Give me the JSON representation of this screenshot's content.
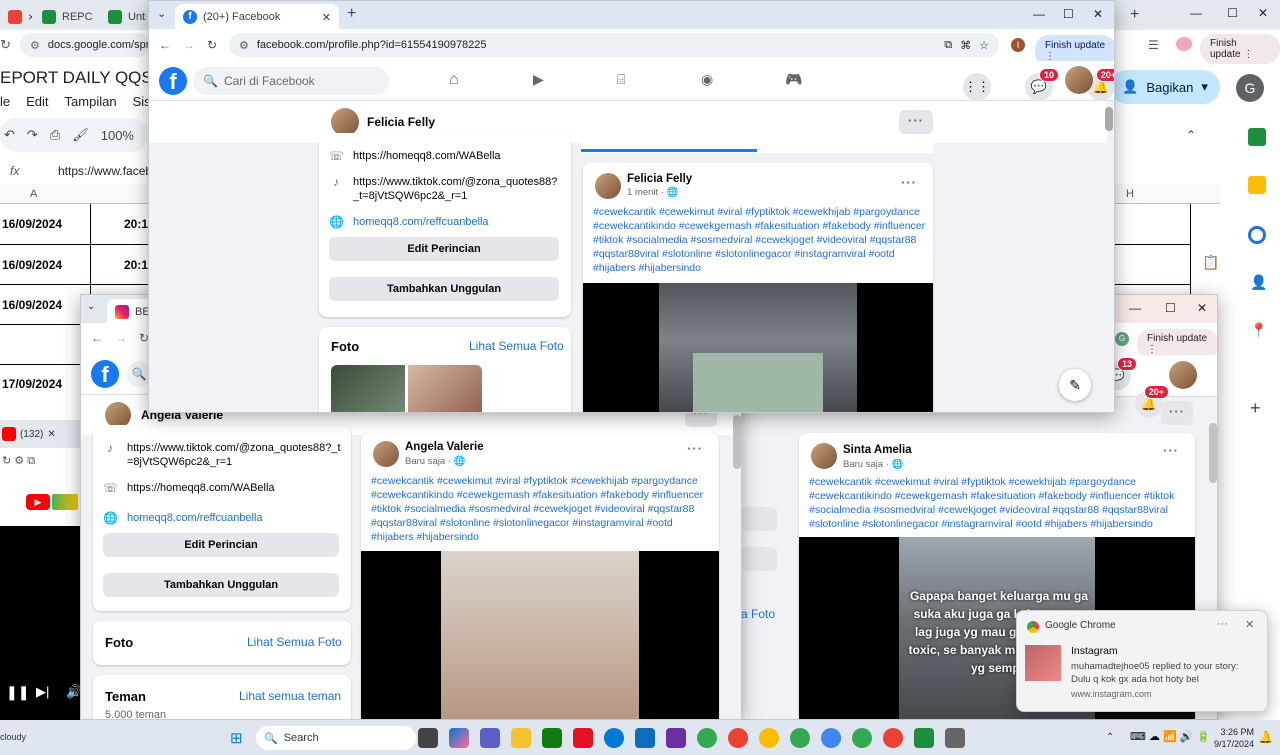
{
  "bg_sheet": {
    "tabs": [
      "REPC",
      "Untit"
    ],
    "url": "docs.google.com/spread",
    "doc_title": "EPORT DAILY QQSTA",
    "menu": [
      "le",
      "Edit",
      "Tampilan",
      "Sisip"
    ],
    "zoom": "100%",
    "cell_ref": "A",
    "formula": "https://www.faceb",
    "col_a": "A",
    "col_h": "H",
    "dates": [
      "16/09/2024",
      "16/09/2024",
      "16/09/2024",
      "17/09/2024"
    ],
    "times": [
      "20:1",
      "20:1"
    ],
    "share_label": "Bagikan",
    "avatar_letter": "G",
    "finish_update": "Finish update"
  },
  "yt_window": {
    "tab_label": "(132)"
  },
  "main_window": {
    "tab_title": "(20+) Facebook",
    "url": "facebook.com/profile.php?id=61554190978225",
    "finish_update": "Finish update",
    "profile_initial": "I",
    "search_placeholder": "Cari di Facebook",
    "messenger_badge": "10",
    "notif_badge": "20+",
    "profile_name": "Felicia Felly",
    "intro": {
      "whatsapp": "https://homeqq8.com/WABella",
      "tiktok": "https://www.tiktok.com/@zona_quotes88?_t=8jVtSQW6pc2&_r=1",
      "website": "homeqq8.com/reffcuanbella",
      "edit_btn": "Edit Perincian",
      "add_btn": "Tambahkan Unggulan"
    },
    "photos_title": "Foto",
    "photos_link": "Lihat Semua Foto",
    "post": {
      "author": "Felicia Felly",
      "time": "1 menit",
      "hashtags": "#cewekcantik #cewekimut #viral #fyptiktok #cewekhijab #pargoydance #cewekcantikindo #cewekgemash #fakesituation #fakebody #influencer #tiktok #socialmedia #sosmedviral #cewekjoget #videoviral #qqstar88 #qqstar88viral #slotonline #slotonlinegacor #instagramviral #ootd #hijabers #hijabersindo"
    }
  },
  "left_window": {
    "tab_title": "BETA",
    "profile_name": "Angela Valerie",
    "intro": {
      "tiktok": "https://www.tiktok.com/@zona_quotes88?_t=8jVtSQW6pc2&_r=1",
      "whatsapp": "https://homeqq8.com/WABella",
      "website": "homeqq8.com/reffcuanbella",
      "edit_btn": "Edit Perincian",
      "add_btn": "Tambahkan Unggulan"
    },
    "photos_title": "Foto",
    "photos_link": "Lihat Semua Foto",
    "friends_title": "Teman",
    "friends_link": "Lihat semua teman",
    "friends_count": "5.000 teman",
    "post": {
      "author": "Angela Valerie",
      "time": "Baru saja",
      "hashtags": "#cewekcantik #cewekimut #viral #fyptiktok #cewekhijab #pargoydance #cewekcantikindo #cewekgemash #fakesituation #fakebody #influencer #tiktok #socialmedia #sosmedviral #cewekjoget #videoviral #qqstar88 #qqstar88viral #slotonline #slotonlinegacor #instagramviral #ootd #hijabers #hijabersindo"
    }
  },
  "right_window": {
    "finish_update": "Finish update",
    "messenger_badge": "13",
    "notif_badge": "20+",
    "photos_link": "a Foto",
    "post": {
      "author": "Sinta Amelia",
      "time": "Baru saja",
      "hashtags": "#cewekcantik #cewekimut #viral #fyptiktok #cewekhijab #pargoydance #cewekcantikindo #cewekgemash #fakesituation #fakebody #influencer #tiktok #socialmedia #sosmedviral #cewekjoget #videoviral #qqstar88 #qqstar88viral #slotonline #slotonlinegacor #instagramviral #ootd #hijabers #hijabersindo",
      "caption": "Gapapa banget keluarga mu ga suka aku juga ga keluargamu, lag juga yg mau gab keluarga toxic, se banyak maunya mantu yg sempu"
    }
  },
  "notification": {
    "app": "Google Chrome",
    "title": "Instagram",
    "body": "muhamadtejhoe05 replied to your story: Dulu q kok gx ada hot hoty bel",
    "source": "www.instagram.com"
  },
  "taskbar": {
    "weather": "cloudy",
    "search": "Search",
    "time": "3:26 PM",
    "date": "9/17/2024"
  }
}
